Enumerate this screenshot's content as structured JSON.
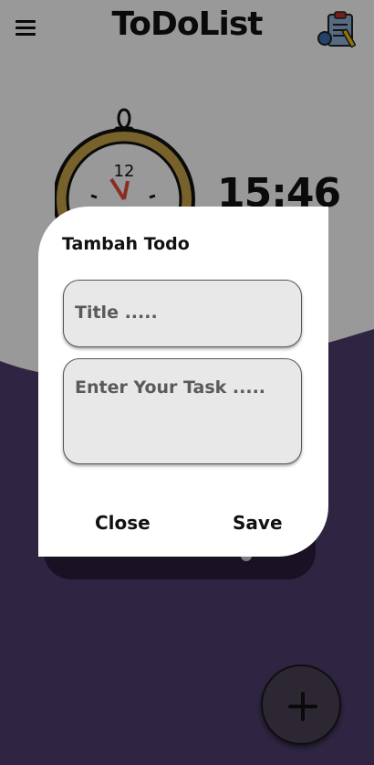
{
  "app": {
    "title": "ToDoList"
  },
  "clock": {
    "digital_time": "15:46",
    "dial_twelve": "12"
  },
  "dialog": {
    "title": "Tambah Todo",
    "title_placeholder": "Title .....",
    "task_placeholder": "Enter Your Task .....",
    "close_label": "Close",
    "save_label": "Save"
  },
  "icons": {
    "menu": "menu-icon",
    "clipboard": "clipboard-icon",
    "add": "plus-icon"
  },
  "colors": {
    "purple": "#2d2143",
    "fab": "#4b4256",
    "clock_rim": "#c9a44a"
  }
}
